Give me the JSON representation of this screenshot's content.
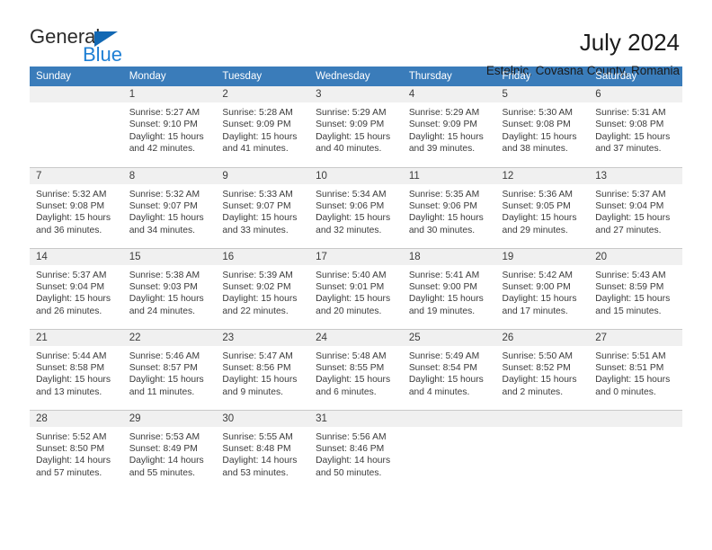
{
  "logo": {
    "word_one": "General",
    "word_two": "Blue",
    "triangle_color": "#1268b3",
    "blue_color": "#1e7fd4"
  },
  "header": {
    "title": "July 2024",
    "subtitle": "Estelnic, Covasna County, Romania"
  },
  "calendar": {
    "header_bg": "#3a7cba",
    "daynum_bg": "#f0f0f0",
    "weekday_headers": [
      "Sunday",
      "Monday",
      "Tuesday",
      "Wednesday",
      "Thursday",
      "Friday",
      "Saturday"
    ],
    "weeks": [
      [
        {
          "day": "",
          "lines": []
        },
        {
          "day": "1",
          "lines": [
            "Sunrise: 5:27 AM",
            "Sunset: 9:10 PM",
            "Daylight: 15 hours",
            "and 42 minutes."
          ]
        },
        {
          "day": "2",
          "lines": [
            "Sunrise: 5:28 AM",
            "Sunset: 9:09 PM",
            "Daylight: 15 hours",
            "and 41 minutes."
          ]
        },
        {
          "day": "3",
          "lines": [
            "Sunrise: 5:29 AM",
            "Sunset: 9:09 PM",
            "Daylight: 15 hours",
            "and 40 minutes."
          ]
        },
        {
          "day": "4",
          "lines": [
            "Sunrise: 5:29 AM",
            "Sunset: 9:09 PM",
            "Daylight: 15 hours",
            "and 39 minutes."
          ]
        },
        {
          "day": "5",
          "lines": [
            "Sunrise: 5:30 AM",
            "Sunset: 9:08 PM",
            "Daylight: 15 hours",
            "and 38 minutes."
          ]
        },
        {
          "day": "6",
          "lines": [
            "Sunrise: 5:31 AM",
            "Sunset: 9:08 PM",
            "Daylight: 15 hours",
            "and 37 minutes."
          ]
        }
      ],
      [
        {
          "day": "7",
          "lines": [
            "Sunrise: 5:32 AM",
            "Sunset: 9:08 PM",
            "Daylight: 15 hours",
            "and 36 minutes."
          ]
        },
        {
          "day": "8",
          "lines": [
            "Sunrise: 5:32 AM",
            "Sunset: 9:07 PM",
            "Daylight: 15 hours",
            "and 34 minutes."
          ]
        },
        {
          "day": "9",
          "lines": [
            "Sunrise: 5:33 AM",
            "Sunset: 9:07 PM",
            "Daylight: 15 hours",
            "and 33 minutes."
          ]
        },
        {
          "day": "10",
          "lines": [
            "Sunrise: 5:34 AM",
            "Sunset: 9:06 PM",
            "Daylight: 15 hours",
            "and 32 minutes."
          ]
        },
        {
          "day": "11",
          "lines": [
            "Sunrise: 5:35 AM",
            "Sunset: 9:06 PM",
            "Daylight: 15 hours",
            "and 30 minutes."
          ]
        },
        {
          "day": "12",
          "lines": [
            "Sunrise: 5:36 AM",
            "Sunset: 9:05 PM",
            "Daylight: 15 hours",
            "and 29 minutes."
          ]
        },
        {
          "day": "13",
          "lines": [
            "Sunrise: 5:37 AM",
            "Sunset: 9:04 PM",
            "Daylight: 15 hours",
            "and 27 minutes."
          ]
        }
      ],
      [
        {
          "day": "14",
          "lines": [
            "Sunrise: 5:37 AM",
            "Sunset: 9:04 PM",
            "Daylight: 15 hours",
            "and 26 minutes."
          ]
        },
        {
          "day": "15",
          "lines": [
            "Sunrise: 5:38 AM",
            "Sunset: 9:03 PM",
            "Daylight: 15 hours",
            "and 24 minutes."
          ]
        },
        {
          "day": "16",
          "lines": [
            "Sunrise: 5:39 AM",
            "Sunset: 9:02 PM",
            "Daylight: 15 hours",
            "and 22 minutes."
          ]
        },
        {
          "day": "17",
          "lines": [
            "Sunrise: 5:40 AM",
            "Sunset: 9:01 PM",
            "Daylight: 15 hours",
            "and 20 minutes."
          ]
        },
        {
          "day": "18",
          "lines": [
            "Sunrise: 5:41 AM",
            "Sunset: 9:00 PM",
            "Daylight: 15 hours",
            "and 19 minutes."
          ]
        },
        {
          "day": "19",
          "lines": [
            "Sunrise: 5:42 AM",
            "Sunset: 9:00 PM",
            "Daylight: 15 hours",
            "and 17 minutes."
          ]
        },
        {
          "day": "20",
          "lines": [
            "Sunrise: 5:43 AM",
            "Sunset: 8:59 PM",
            "Daylight: 15 hours",
            "and 15 minutes."
          ]
        }
      ],
      [
        {
          "day": "21",
          "lines": [
            "Sunrise: 5:44 AM",
            "Sunset: 8:58 PM",
            "Daylight: 15 hours",
            "and 13 minutes."
          ]
        },
        {
          "day": "22",
          "lines": [
            "Sunrise: 5:46 AM",
            "Sunset: 8:57 PM",
            "Daylight: 15 hours",
            "and 11 minutes."
          ]
        },
        {
          "day": "23",
          "lines": [
            "Sunrise: 5:47 AM",
            "Sunset: 8:56 PM",
            "Daylight: 15 hours",
            "and 9 minutes."
          ]
        },
        {
          "day": "24",
          "lines": [
            "Sunrise: 5:48 AM",
            "Sunset: 8:55 PM",
            "Daylight: 15 hours",
            "and 6 minutes."
          ]
        },
        {
          "day": "25",
          "lines": [
            "Sunrise: 5:49 AM",
            "Sunset: 8:54 PM",
            "Daylight: 15 hours",
            "and 4 minutes."
          ]
        },
        {
          "day": "26",
          "lines": [
            "Sunrise: 5:50 AM",
            "Sunset: 8:52 PM",
            "Daylight: 15 hours",
            "and 2 minutes."
          ]
        },
        {
          "day": "27",
          "lines": [
            "Sunrise: 5:51 AM",
            "Sunset: 8:51 PM",
            "Daylight: 15 hours",
            "and 0 minutes."
          ]
        }
      ],
      [
        {
          "day": "28",
          "lines": [
            "Sunrise: 5:52 AM",
            "Sunset: 8:50 PM",
            "Daylight: 14 hours",
            "and 57 minutes."
          ]
        },
        {
          "day": "29",
          "lines": [
            "Sunrise: 5:53 AM",
            "Sunset: 8:49 PM",
            "Daylight: 14 hours",
            "and 55 minutes."
          ]
        },
        {
          "day": "30",
          "lines": [
            "Sunrise: 5:55 AM",
            "Sunset: 8:48 PM",
            "Daylight: 14 hours",
            "and 53 minutes."
          ]
        },
        {
          "day": "31",
          "lines": [
            "Sunrise: 5:56 AM",
            "Sunset: 8:46 PM",
            "Daylight: 14 hours",
            "and 50 minutes."
          ]
        },
        {
          "day": "",
          "lines": []
        },
        {
          "day": "",
          "lines": []
        },
        {
          "day": "",
          "lines": []
        }
      ]
    ]
  }
}
